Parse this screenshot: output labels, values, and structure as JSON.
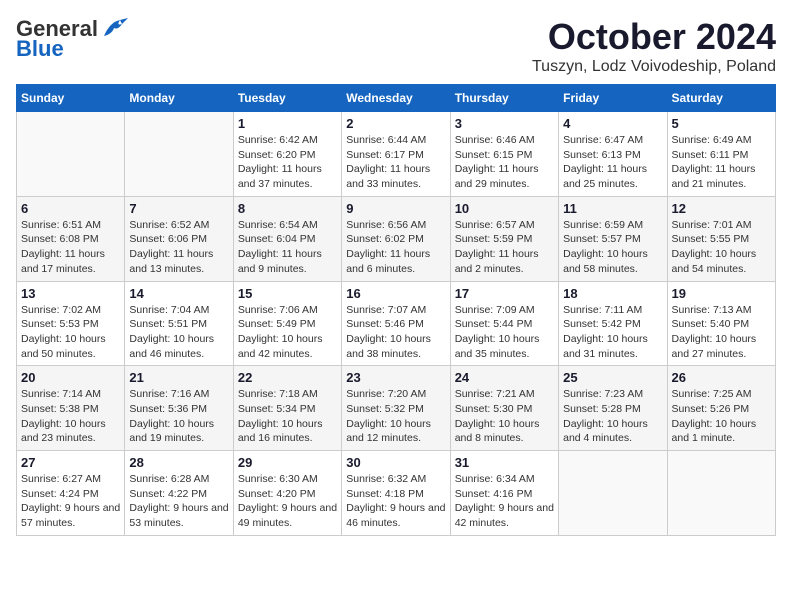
{
  "header": {
    "logo_general": "General",
    "logo_blue": "Blue",
    "month": "October 2024",
    "location": "Tuszyn, Lodz Voivodeship, Poland"
  },
  "weekdays": [
    "Sunday",
    "Monday",
    "Tuesday",
    "Wednesday",
    "Thursday",
    "Friday",
    "Saturday"
  ],
  "weeks": [
    [
      {
        "day": "",
        "info": ""
      },
      {
        "day": "",
        "info": ""
      },
      {
        "day": "1",
        "info": "Sunrise: 6:42 AM\nSunset: 6:20 PM\nDaylight: 11 hours and 37 minutes."
      },
      {
        "day": "2",
        "info": "Sunrise: 6:44 AM\nSunset: 6:17 PM\nDaylight: 11 hours and 33 minutes."
      },
      {
        "day": "3",
        "info": "Sunrise: 6:46 AM\nSunset: 6:15 PM\nDaylight: 11 hours and 29 minutes."
      },
      {
        "day": "4",
        "info": "Sunrise: 6:47 AM\nSunset: 6:13 PM\nDaylight: 11 hours and 25 minutes."
      },
      {
        "day": "5",
        "info": "Sunrise: 6:49 AM\nSunset: 6:11 PM\nDaylight: 11 hours and 21 minutes."
      }
    ],
    [
      {
        "day": "6",
        "info": "Sunrise: 6:51 AM\nSunset: 6:08 PM\nDaylight: 11 hours and 17 minutes."
      },
      {
        "day": "7",
        "info": "Sunrise: 6:52 AM\nSunset: 6:06 PM\nDaylight: 11 hours and 13 minutes."
      },
      {
        "day": "8",
        "info": "Sunrise: 6:54 AM\nSunset: 6:04 PM\nDaylight: 11 hours and 9 minutes."
      },
      {
        "day": "9",
        "info": "Sunrise: 6:56 AM\nSunset: 6:02 PM\nDaylight: 11 hours and 6 minutes."
      },
      {
        "day": "10",
        "info": "Sunrise: 6:57 AM\nSunset: 5:59 PM\nDaylight: 11 hours and 2 minutes."
      },
      {
        "day": "11",
        "info": "Sunrise: 6:59 AM\nSunset: 5:57 PM\nDaylight: 10 hours and 58 minutes."
      },
      {
        "day": "12",
        "info": "Sunrise: 7:01 AM\nSunset: 5:55 PM\nDaylight: 10 hours and 54 minutes."
      }
    ],
    [
      {
        "day": "13",
        "info": "Sunrise: 7:02 AM\nSunset: 5:53 PM\nDaylight: 10 hours and 50 minutes."
      },
      {
        "day": "14",
        "info": "Sunrise: 7:04 AM\nSunset: 5:51 PM\nDaylight: 10 hours and 46 minutes."
      },
      {
        "day": "15",
        "info": "Sunrise: 7:06 AM\nSunset: 5:49 PM\nDaylight: 10 hours and 42 minutes."
      },
      {
        "day": "16",
        "info": "Sunrise: 7:07 AM\nSunset: 5:46 PM\nDaylight: 10 hours and 38 minutes."
      },
      {
        "day": "17",
        "info": "Sunrise: 7:09 AM\nSunset: 5:44 PM\nDaylight: 10 hours and 35 minutes."
      },
      {
        "day": "18",
        "info": "Sunrise: 7:11 AM\nSunset: 5:42 PM\nDaylight: 10 hours and 31 minutes."
      },
      {
        "day": "19",
        "info": "Sunrise: 7:13 AM\nSunset: 5:40 PM\nDaylight: 10 hours and 27 minutes."
      }
    ],
    [
      {
        "day": "20",
        "info": "Sunrise: 7:14 AM\nSunset: 5:38 PM\nDaylight: 10 hours and 23 minutes."
      },
      {
        "day": "21",
        "info": "Sunrise: 7:16 AM\nSunset: 5:36 PM\nDaylight: 10 hours and 19 minutes."
      },
      {
        "day": "22",
        "info": "Sunrise: 7:18 AM\nSunset: 5:34 PM\nDaylight: 10 hours and 16 minutes."
      },
      {
        "day": "23",
        "info": "Sunrise: 7:20 AM\nSunset: 5:32 PM\nDaylight: 10 hours and 12 minutes."
      },
      {
        "day": "24",
        "info": "Sunrise: 7:21 AM\nSunset: 5:30 PM\nDaylight: 10 hours and 8 minutes."
      },
      {
        "day": "25",
        "info": "Sunrise: 7:23 AM\nSunset: 5:28 PM\nDaylight: 10 hours and 4 minutes."
      },
      {
        "day": "26",
        "info": "Sunrise: 7:25 AM\nSunset: 5:26 PM\nDaylight: 10 hours and 1 minute."
      }
    ],
    [
      {
        "day": "27",
        "info": "Sunrise: 6:27 AM\nSunset: 4:24 PM\nDaylight: 9 hours and 57 minutes."
      },
      {
        "day": "28",
        "info": "Sunrise: 6:28 AM\nSunset: 4:22 PM\nDaylight: 9 hours and 53 minutes."
      },
      {
        "day": "29",
        "info": "Sunrise: 6:30 AM\nSunset: 4:20 PM\nDaylight: 9 hours and 49 minutes."
      },
      {
        "day": "30",
        "info": "Sunrise: 6:32 AM\nSunset: 4:18 PM\nDaylight: 9 hours and 46 minutes."
      },
      {
        "day": "31",
        "info": "Sunrise: 6:34 AM\nSunset: 4:16 PM\nDaylight: 9 hours and 42 minutes."
      },
      {
        "day": "",
        "info": ""
      },
      {
        "day": "",
        "info": ""
      }
    ]
  ]
}
